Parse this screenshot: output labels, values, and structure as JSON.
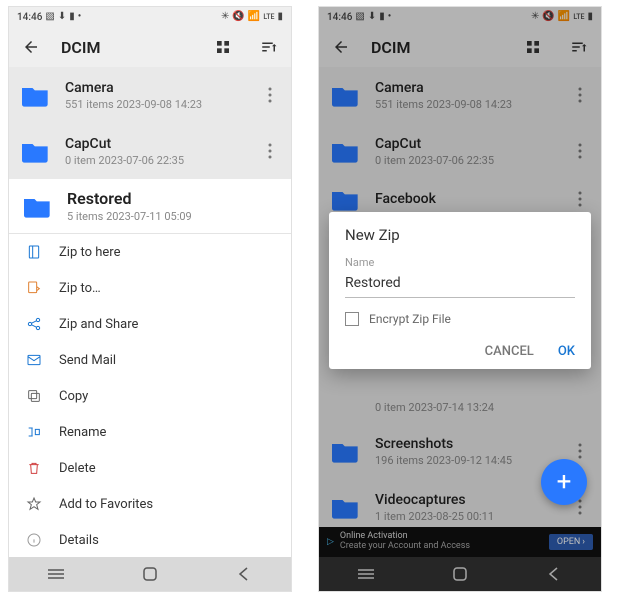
{
  "status": {
    "time": "14:46",
    "left_icons": [
      "▧",
      "⬇",
      "▮",
      "•"
    ],
    "right_icons": [
      "✳",
      "🔇",
      "📶",
      "ᴸᵀᴱ",
      "▮"
    ]
  },
  "appbar": {
    "title": "DCIM"
  },
  "left": {
    "folders_dim": [
      {
        "name": "Camera",
        "meta": "551 items  2023-09-08 14:23"
      },
      {
        "name": "CapCut",
        "meta": "0 item  2023-07-06 22:35"
      }
    ],
    "selected": {
      "name": "Restored",
      "meta": "5 items  2023-07-11 05:09"
    },
    "menu": [
      {
        "key": "zip-here",
        "label": "Zip to here",
        "color": "#1976d2"
      },
      {
        "key": "zip-to",
        "label": "Zip to…",
        "color": "#e08030"
      },
      {
        "key": "zip-share",
        "label": "Zip and Share",
        "color": "#1976d2"
      },
      {
        "key": "send-mail",
        "label": "Send Mail",
        "color": "#1976d2"
      },
      {
        "key": "copy",
        "label": "Copy",
        "color": "#666"
      },
      {
        "key": "rename",
        "label": "Rename",
        "color": "#1976d2"
      },
      {
        "key": "delete",
        "label": "Delete",
        "color": "#d04040"
      },
      {
        "key": "favorite",
        "label": "Add to Favorites",
        "color": "#666"
      },
      {
        "key": "details",
        "label": "Details",
        "color": "#999"
      }
    ]
  },
  "right": {
    "folders": [
      {
        "name": "Camera",
        "meta": "551 items  2023-09-08 14:23"
      },
      {
        "name": "CapCut",
        "meta": "0 item  2023-07-06 22:35"
      },
      {
        "name": "Facebook",
        "meta": ""
      },
      {
        "name": "",
        "meta": "0 item  2023-07-14 13:24"
      },
      {
        "name": "Screenshots",
        "meta": "196 items  2023-09-12 14:45"
      },
      {
        "name": "Videocaptures",
        "meta": "1 item  2023-08-25 00:11"
      }
    ],
    "dialog": {
      "title": "New Zip",
      "field_label": "Name",
      "value": "Restored",
      "encrypt_label": "Encrypt Zip File",
      "cancel": "CANCEL",
      "ok": "OK"
    },
    "ad": {
      "line1": "Online Activation",
      "line2": "Create your Account and Access",
      "cta": "OPEN"
    }
  }
}
